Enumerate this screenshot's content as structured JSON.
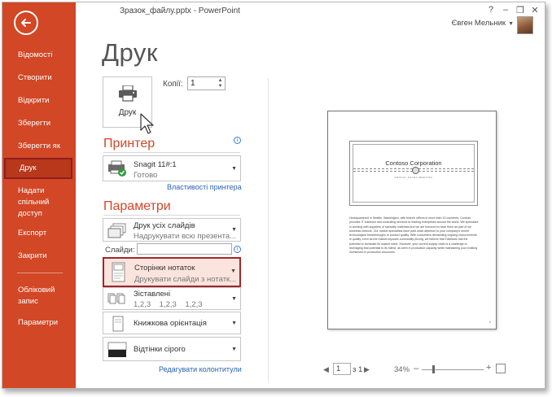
{
  "window": {
    "title": "Зразок_файлу.pptx - PowerPoint",
    "user_name": "Євген Мельник",
    "controls": [
      "?",
      "–",
      "❐",
      "✕"
    ]
  },
  "nav": {
    "back_icon": "arrow-left-icon",
    "items": [
      {
        "label": "Відомості"
      },
      {
        "label": "Створити"
      },
      {
        "label": "Відкрити"
      },
      {
        "label": "Зберегти"
      },
      {
        "label": "Зберегти як"
      },
      {
        "label": "Друк"
      },
      {
        "label": "Надати спільний доступ"
      },
      {
        "label": "Експорт"
      },
      {
        "label": "Закрити"
      },
      {
        "label": "Обліковий запис"
      },
      {
        "label": "Параметри"
      }
    ],
    "accent_color": "#d24726"
  },
  "main": {
    "page_title": "Друк",
    "print_button_label": "Друк",
    "copies_label": "Копії:",
    "copies_value": "1"
  },
  "printer": {
    "section_title": "Принтер",
    "name": "Snagit 11#:1",
    "status": "Готово",
    "properties_link": "Властивості принтера"
  },
  "settings": {
    "section_title": "Параметри",
    "print_range_main": "Друк усіх слайдів",
    "print_range_sub": "Надрукувати всю презента...",
    "slides_label": "Слайди:",
    "slides_value": "",
    "layout_main": "Сторінки нотаток",
    "layout_sub": "Друкувати слайди з нотатк...",
    "collation_main": "Зіставлені",
    "collation_sub": "1,2,3    1,2,3    1,2,3",
    "orientation": "Книжкова орієнтація",
    "color": "Відтінки сірого",
    "headers_link": "Редагувати колонтитули"
  },
  "preview": {
    "slide_title": "Contoso Corporation",
    "slide_subtitle": "ANNUAL SALES MEETING",
    "notes": "Headquartered in Seattle, Washington, with branch offices in more than 10 countries, Contoso provides IT solutions and consulting services to leading enterprises around the world. We specialize in working with suppliers of specialty materials and we are honored to have them as part of our business network. Our market specialists have paid close attention to your company's recent technological breakthroughs in product quality. With consumers demanding ongoing improvements in quality, even as the market imposes commodity pricing, we believe that Fabrikam has the potential to dominate its market niche. However, your current supply chain is a challenge to leveraging that potential to its fullest, as seen in production capacity while maintaining your existing investment in production resources.",
    "page_number_on_page": "1",
    "current_page": "1",
    "of_pages": "з 1",
    "zoom": "34%"
  }
}
